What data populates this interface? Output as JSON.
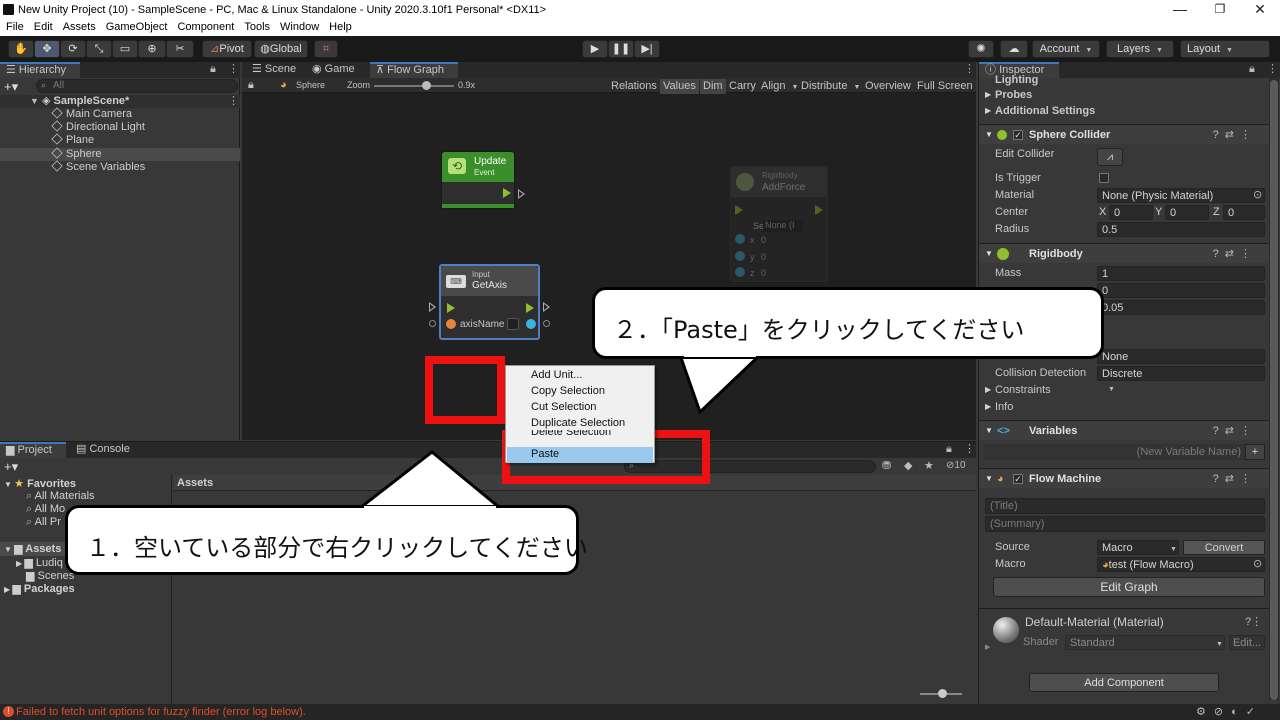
{
  "titlebar": {
    "title": "New Unity Project (10) - SampleScene - PC, Mac & Linux Standalone - Unity 2020.3.10f1 Personal* <DX11>",
    "minimize": "—",
    "maximize": "❐",
    "close": "✕"
  },
  "menu": [
    "File",
    "Edit",
    "Assets",
    "GameObject",
    "Component",
    "Tools",
    "Window",
    "Help"
  ],
  "toolbar": {
    "pivot": "Pivot",
    "global": "Global",
    "account": "Account",
    "layers": "Layers",
    "layout": "Layout"
  },
  "hierarchy": {
    "tab": "Hierarchy",
    "search_placeholder": "All",
    "scene": "SampleScene*",
    "items": [
      "Main Camera",
      "Directional Light",
      "Plane",
      "Sphere",
      "Scene Variables"
    ]
  },
  "center_tabs": [
    "Scene",
    "Game",
    "Flow Graph"
  ],
  "graph_toolbar": {
    "target": "Sphere",
    "zoom_label": "Zoom",
    "zoom_value": "0.9x",
    "zoom_level": 0.9,
    "buttons": [
      "Relations",
      "Values",
      "Dim",
      "Carry",
      "Align",
      "Distribute",
      "Overview",
      "Full Screen"
    ]
  },
  "nodes": {
    "update": {
      "title": "Update",
      "subtitle": "Event"
    },
    "getaxis": {
      "category": "Input",
      "title": "GetAxis",
      "port_label": "axisName"
    },
    "addforce": {
      "category": "Rigidbody",
      "title": "AddForce",
      "self_label": "Self",
      "self_value": "None (I",
      "x": "x",
      "y": "y",
      "z": "z",
      "xv": "0",
      "yv": "0",
      "zv": "0"
    }
  },
  "context_menu": [
    "Add Unit...",
    "Copy Selection",
    "Cut Selection",
    "Duplicate Selection",
    "Delete Selection",
    "Paste"
  ],
  "project": {
    "tabs": [
      "Project",
      "Console"
    ],
    "favorites": "Favorites",
    "favorite_items": [
      "All Materials",
      "All Mo",
      "All Pr"
    ],
    "assets": "Assets",
    "asset_items": [
      "Ludiq",
      "Scenes"
    ],
    "packages": "Packages",
    "header": "Assets",
    "count": "10"
  },
  "inspector": {
    "tab": "Inspector",
    "collapsed_rows": [
      "Lighting",
      "Probes",
      "Additional Settings"
    ],
    "sphere_collider": {
      "title": "Sphere Collider",
      "edit_collider": "Edit Collider",
      "is_trigger": "Is Trigger",
      "material": "Material",
      "material_value": "None (Physic Material)",
      "center": "Center",
      "cx": "X",
      "cxv": "0",
      "cy": "Y",
      "cyv": "0",
      "cz": "Z",
      "czv": "0",
      "radius": "Radius",
      "radius_value": "0.5"
    },
    "rigidbody": {
      "title": "Rigidbody",
      "mass": "Mass",
      "mass_value": "1",
      "drag_value": "0",
      "angular_value": "0.05",
      "interpolate_value": "None",
      "collision_detection": "Collision Detection",
      "collision_value": "Discrete",
      "constraints": "Constraints",
      "info": "Info"
    },
    "variables": {
      "title": "Variables",
      "placeholder": "(New Variable Name)",
      "add": "+"
    },
    "flow_machine": {
      "title": "Flow Machine",
      "title_placeholder": "(Title)",
      "summary_placeholder": "(Summary)",
      "source": "Source",
      "source_value": "Macro",
      "convert": "Convert",
      "macro": "Macro",
      "macro_value": "test (Flow Macro)",
      "edit_graph": "Edit Graph"
    },
    "material": {
      "title": "Default-Material (Material)",
      "shader": "Shader",
      "shader_value": "Standard",
      "edit": "Edit..."
    },
    "add_component": "Add Component"
  },
  "status": {
    "error": "Failed to fetch unit options for fuzzy finder (error log below)."
  },
  "callouts": {
    "step1": "１．空いている部分で右クリックしてください",
    "step2": "２．「Paste」をクリックしてください"
  },
  "colors": {
    "accent": "#3a79bb",
    "highlight": "#99c9ef",
    "annotation_red": "#ee1111",
    "flow_green": "#8ec02e",
    "event_green": "#3a8f2a"
  }
}
